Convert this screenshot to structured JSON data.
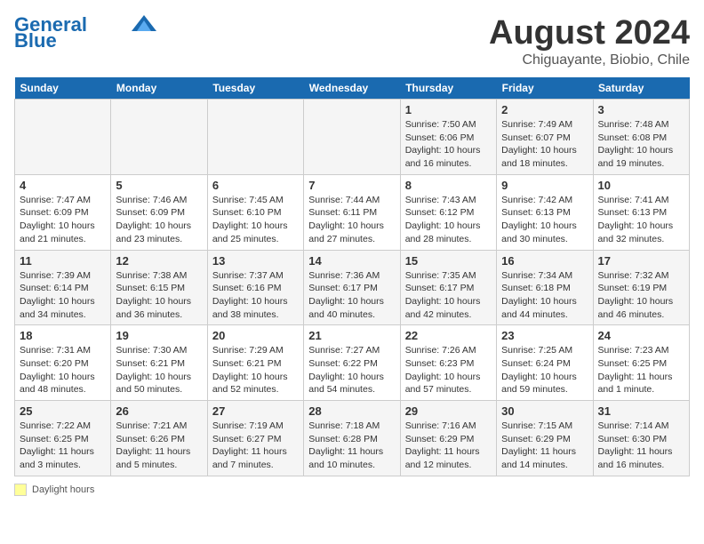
{
  "header": {
    "logo_line1": "General",
    "logo_line2": "Blue",
    "title": "August 2024",
    "subtitle": "Chiguayante, Biobio, Chile"
  },
  "columns": [
    "Sunday",
    "Monday",
    "Tuesday",
    "Wednesday",
    "Thursday",
    "Friday",
    "Saturday"
  ],
  "weeks": [
    [
      {
        "day": "",
        "info": ""
      },
      {
        "day": "",
        "info": ""
      },
      {
        "day": "",
        "info": ""
      },
      {
        "day": "",
        "info": ""
      },
      {
        "day": "1",
        "info": "Sunrise: 7:50 AM\nSunset: 6:06 PM\nDaylight: 10 hours and 16 minutes."
      },
      {
        "day": "2",
        "info": "Sunrise: 7:49 AM\nSunset: 6:07 PM\nDaylight: 10 hours and 18 minutes."
      },
      {
        "day": "3",
        "info": "Sunrise: 7:48 AM\nSunset: 6:08 PM\nDaylight: 10 hours and 19 minutes."
      }
    ],
    [
      {
        "day": "4",
        "info": "Sunrise: 7:47 AM\nSunset: 6:09 PM\nDaylight: 10 hours and 21 minutes."
      },
      {
        "day": "5",
        "info": "Sunrise: 7:46 AM\nSunset: 6:09 PM\nDaylight: 10 hours and 23 minutes."
      },
      {
        "day": "6",
        "info": "Sunrise: 7:45 AM\nSunset: 6:10 PM\nDaylight: 10 hours and 25 minutes."
      },
      {
        "day": "7",
        "info": "Sunrise: 7:44 AM\nSunset: 6:11 PM\nDaylight: 10 hours and 27 minutes."
      },
      {
        "day": "8",
        "info": "Sunrise: 7:43 AM\nSunset: 6:12 PM\nDaylight: 10 hours and 28 minutes."
      },
      {
        "day": "9",
        "info": "Sunrise: 7:42 AM\nSunset: 6:13 PM\nDaylight: 10 hours and 30 minutes."
      },
      {
        "day": "10",
        "info": "Sunrise: 7:41 AM\nSunset: 6:13 PM\nDaylight: 10 hours and 32 minutes."
      }
    ],
    [
      {
        "day": "11",
        "info": "Sunrise: 7:39 AM\nSunset: 6:14 PM\nDaylight: 10 hours and 34 minutes."
      },
      {
        "day": "12",
        "info": "Sunrise: 7:38 AM\nSunset: 6:15 PM\nDaylight: 10 hours and 36 minutes."
      },
      {
        "day": "13",
        "info": "Sunrise: 7:37 AM\nSunset: 6:16 PM\nDaylight: 10 hours and 38 minutes."
      },
      {
        "day": "14",
        "info": "Sunrise: 7:36 AM\nSunset: 6:17 PM\nDaylight: 10 hours and 40 minutes."
      },
      {
        "day": "15",
        "info": "Sunrise: 7:35 AM\nSunset: 6:17 PM\nDaylight: 10 hours and 42 minutes."
      },
      {
        "day": "16",
        "info": "Sunrise: 7:34 AM\nSunset: 6:18 PM\nDaylight: 10 hours and 44 minutes."
      },
      {
        "day": "17",
        "info": "Sunrise: 7:32 AM\nSunset: 6:19 PM\nDaylight: 10 hours and 46 minutes."
      }
    ],
    [
      {
        "day": "18",
        "info": "Sunrise: 7:31 AM\nSunset: 6:20 PM\nDaylight: 10 hours and 48 minutes."
      },
      {
        "day": "19",
        "info": "Sunrise: 7:30 AM\nSunset: 6:21 PM\nDaylight: 10 hours and 50 minutes."
      },
      {
        "day": "20",
        "info": "Sunrise: 7:29 AM\nSunset: 6:21 PM\nDaylight: 10 hours and 52 minutes."
      },
      {
        "day": "21",
        "info": "Sunrise: 7:27 AM\nSunset: 6:22 PM\nDaylight: 10 hours and 54 minutes."
      },
      {
        "day": "22",
        "info": "Sunrise: 7:26 AM\nSunset: 6:23 PM\nDaylight: 10 hours and 57 minutes."
      },
      {
        "day": "23",
        "info": "Sunrise: 7:25 AM\nSunset: 6:24 PM\nDaylight: 10 hours and 59 minutes."
      },
      {
        "day": "24",
        "info": "Sunrise: 7:23 AM\nSunset: 6:25 PM\nDaylight: 11 hours and 1 minute."
      }
    ],
    [
      {
        "day": "25",
        "info": "Sunrise: 7:22 AM\nSunset: 6:25 PM\nDaylight: 11 hours and 3 minutes."
      },
      {
        "day": "26",
        "info": "Sunrise: 7:21 AM\nSunset: 6:26 PM\nDaylight: 11 hours and 5 minutes."
      },
      {
        "day": "27",
        "info": "Sunrise: 7:19 AM\nSunset: 6:27 PM\nDaylight: 11 hours and 7 minutes."
      },
      {
        "day": "28",
        "info": "Sunrise: 7:18 AM\nSunset: 6:28 PM\nDaylight: 11 hours and 10 minutes."
      },
      {
        "day": "29",
        "info": "Sunrise: 7:16 AM\nSunset: 6:29 PM\nDaylight: 11 hours and 12 minutes."
      },
      {
        "day": "30",
        "info": "Sunrise: 7:15 AM\nSunset: 6:29 PM\nDaylight: 11 hours and 14 minutes."
      },
      {
        "day": "31",
        "info": "Sunrise: 7:14 AM\nSunset: 6:30 PM\nDaylight: 11 hours and 16 minutes."
      }
    ]
  ],
  "legend": {
    "box_label": "Daylight hours"
  }
}
